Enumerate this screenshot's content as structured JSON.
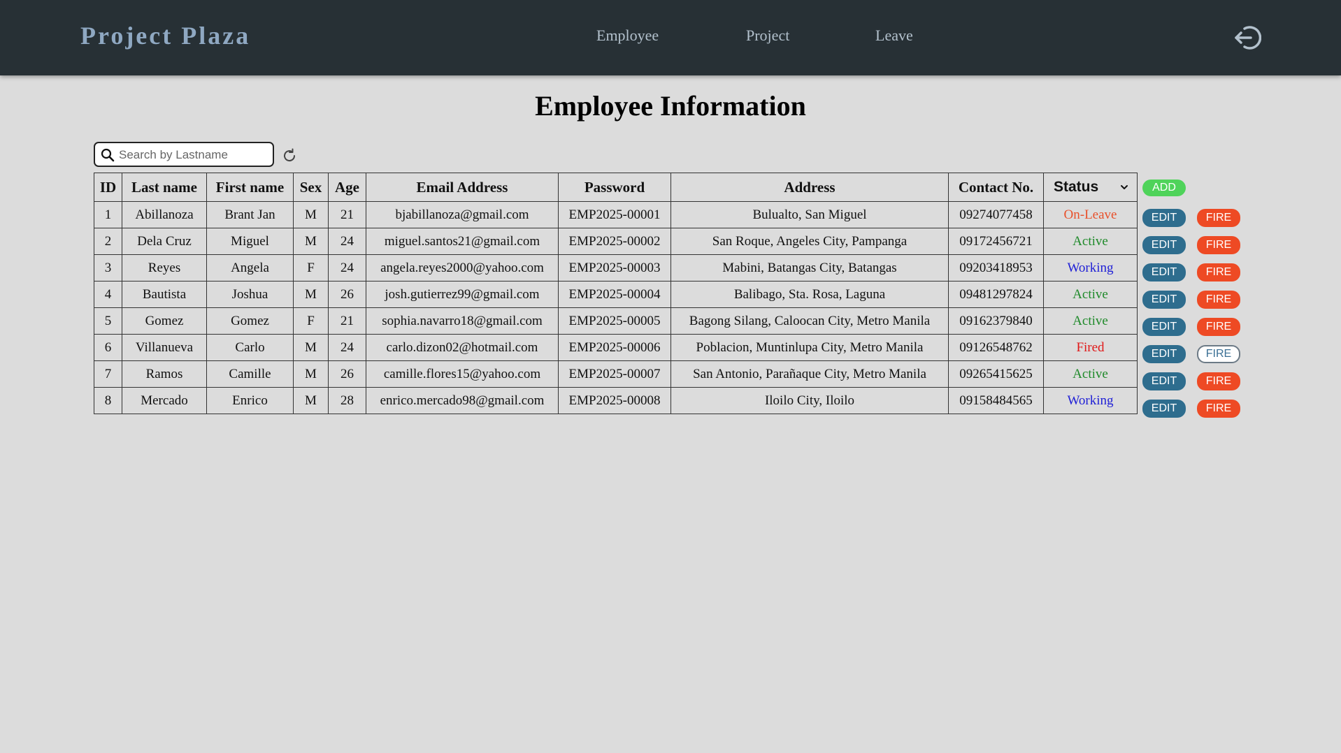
{
  "nav": {
    "brand": "Project Plaza",
    "links": [
      "Employee",
      "Project",
      "Leave"
    ]
  },
  "page": {
    "title": "Employee Information"
  },
  "search": {
    "placeholder": "Search by Lastname",
    "value": ""
  },
  "table": {
    "headers": [
      "ID",
      "Last name",
      "First name",
      "Sex",
      "Age",
      "Email Address",
      "Password",
      "Address",
      "Contact No.",
      "Status"
    ],
    "rows": [
      {
        "id": "1",
        "last": "Abillanoza",
        "first": "Brant Jan",
        "sex": "M",
        "age": "21",
        "email": "bjabillanoza@gmail.com",
        "password": "EMP2025-00001",
        "address": "Bulualto, San Miguel",
        "contact": "09274077458",
        "status": "On-Leave",
        "status_color": "#e8502a",
        "fired": false
      },
      {
        "id": "2",
        "last": "Dela Cruz",
        "first": "Miguel",
        "sex": "M",
        "age": "24",
        "email": "miguel.santos21@gmail.com",
        "password": "EMP2025-00002",
        "address": "San Roque, Angeles City, Pampanga",
        "contact": "09172456721",
        "status": "Active",
        "status_color": "#1f8a2a",
        "fired": false
      },
      {
        "id": "3",
        "last": "Reyes",
        "first": "Angela",
        "sex": "F",
        "age": "24",
        "email": "angela.reyes2000@yahoo.com",
        "password": "EMP2025-00003",
        "address": "Mabini, Batangas City, Batangas",
        "contact": "09203418953",
        "status": "Working",
        "status_color": "#1f1fd6",
        "fired": false
      },
      {
        "id": "4",
        "last": "Bautista",
        "first": "Joshua",
        "sex": "M",
        "age": "26",
        "email": "josh.gutierrez99@gmail.com",
        "password": "EMP2025-00004",
        "address": "Balibago, Sta. Rosa, Laguna",
        "contact": "09481297824",
        "status": "Active",
        "status_color": "#1f8a2a",
        "fired": false
      },
      {
        "id": "5",
        "last": "Gomez",
        "first": "Gomez",
        "sex": "F",
        "age": "21",
        "email": "sophia.navarro18@gmail.com",
        "password": "EMP2025-00005",
        "address": "Bagong Silang, Caloocan City, Metro Manila",
        "contact": "09162379840",
        "status": "Active",
        "status_color": "#1f8a2a",
        "fired": false
      },
      {
        "id": "6",
        "last": "Villanueva",
        "first": "Carlo",
        "sex": "M",
        "age": "24",
        "email": "carlo.dizon02@hotmail.com",
        "password": "EMP2025-00006",
        "address": "Poblacion, Muntinlupa City, Metro Manila",
        "contact": "09126548762",
        "status": "Fired",
        "status_color": "#e01818",
        "fired": true
      },
      {
        "id": "7",
        "last": "Ramos",
        "first": "Camille",
        "sex": "M",
        "age": "26",
        "email": "camille.flores15@yahoo.com",
        "password": "EMP2025-00007",
        "address": "San Antonio, Parañaque City, Metro Manila",
        "contact": "09265415625",
        "status": "Active",
        "status_color": "#1f8a2a",
        "fired": false
      },
      {
        "id": "8",
        "last": "Mercado",
        "first": "Enrico",
        "sex": "M",
        "age": "28",
        "email": "enrico.mercado98@gmail.com",
        "password": "EMP2025-00008",
        "address": "Iloilo City, Iloilo",
        "contact": "09158484565",
        "status": "Working",
        "status_color": "#1f1fd6",
        "fired": false
      }
    ]
  },
  "actions": {
    "add_label": "ADD",
    "edit_label": "EDIT",
    "fire_label": "FIRE"
  },
  "icons": {
    "logout": "logout-icon",
    "search": "search-icon",
    "refresh": "refresh-icon",
    "status_dropdown": "chevron-down-icon"
  },
  "colors": {
    "navbar": "#273035",
    "brand": "#8fa8c2",
    "background": "#dcdcdc",
    "add": "#4fd35a",
    "edit": "#2e6d8e",
    "fire": "#ee4a24"
  }
}
